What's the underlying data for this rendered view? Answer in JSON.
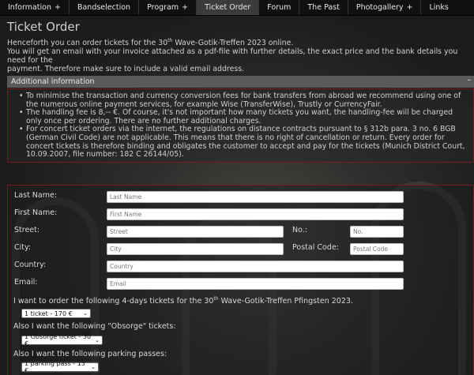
{
  "nav": {
    "items": [
      {
        "label": "Information",
        "suffix": "+"
      },
      {
        "label": "Bandselection",
        "suffix": ""
      },
      {
        "label": "Program",
        "suffix": "+"
      },
      {
        "label": "Ticket Order",
        "suffix": ""
      },
      {
        "label": "Forum",
        "suffix": ""
      },
      {
        "label": "The Past",
        "suffix": ""
      },
      {
        "label": "Photogallery",
        "suffix": "+"
      },
      {
        "label": "Links",
        "suffix": ""
      }
    ],
    "active": "Ticket Order"
  },
  "page": {
    "title": "Ticket Order",
    "intro_line1_pre": "Henceforth you can order tickets for the 30",
    "intro_line1_sup": "th",
    "intro_line1_post": " Wave-Gotik-Treffen 2023 online.",
    "intro_line2": "You will get an email with your invoice attached as a pdf-file with further details, the exact price and the bank details you need for the",
    "intro_line3": "payment. Therefore make sure to include a valid email address."
  },
  "info": {
    "header": "Additional information",
    "collapse_symbol": "–",
    "bullets": [
      "To minimise the transaction and currency conversion fees for bank transfers from abroad we recommend using one of the numerous online payment services, for example Wise (TransferWise), Trustly or CurrencyFair.",
      "The handling fee is 8,-- €. Of course, it's not important how many tickets you want, the handling-fee will be charged only once per ordering. There are no further additional charges.",
      "For concert ticket orders via the internet, the regulations on distance contracts pursuant to § 312b para. 3 no. 6 BGB (German Civil Code) are not applicable. This means that there is no right of cancellation or return. Every order for concert tickets is therefore binding and obligates the customer to accept and pay for the tickets (Munich District Court, 10.09.2007, file number: 182 C 26144/05)."
    ]
  },
  "form": {
    "last_name": {
      "label": "Last Name:",
      "placeholder": "Last Name",
      "value": ""
    },
    "first_name": {
      "label": "First Name:",
      "placeholder": "First Name",
      "value": ""
    },
    "street": {
      "label": "Street:",
      "placeholder": "Street",
      "value": ""
    },
    "number": {
      "label": "No.:",
      "placeholder": "No.",
      "value": ""
    },
    "city": {
      "label": "City:",
      "placeholder": "City",
      "value": ""
    },
    "postal_code": {
      "label": "Postal Code:",
      "placeholder": "Postal Code",
      "value": ""
    },
    "country": {
      "label": "Country:",
      "placeholder": "Country",
      "value": ""
    },
    "email": {
      "label": "Email:",
      "placeholder": "Email",
      "value": ""
    },
    "q_tickets_pre": "I want to order the following 4-days tickets for the 30",
    "q_tickets_sup": "th",
    "q_tickets_post": " Wave-Gotik-Treffen Pfingsten 2023.",
    "tickets_selected": "1 ticket - 170 €",
    "q_obsorge": "Also I want the following \"Obsorge\" tickets:",
    "obsorge_selected": "1 Obsorge ticket - 30 €",
    "q_parking": "Also I want the following parking passes:",
    "parking_selected": "1 parking pass - 15 €"
  },
  "icons": {
    "chevron": "chevron-down-icon"
  }
}
